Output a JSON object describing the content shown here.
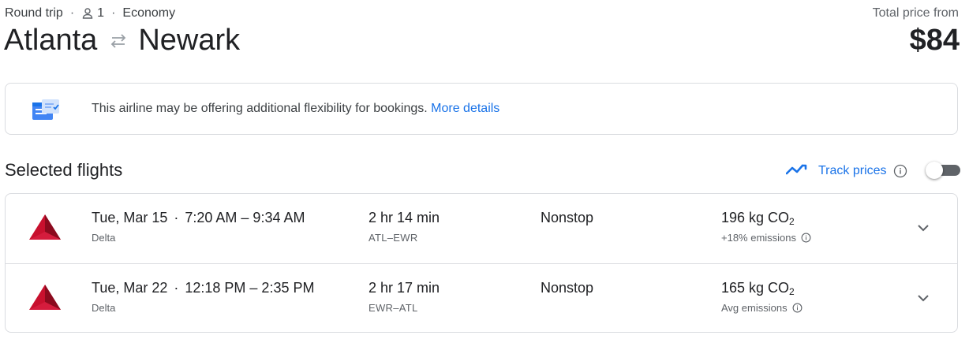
{
  "header": {
    "trip_type": "Round trip",
    "passengers": "1",
    "cabin": "Economy",
    "origin": "Atlanta",
    "destination": "Newark",
    "price_label": "Total price from",
    "price": "$84"
  },
  "banner": {
    "text": "This airline may be offering additional flexibility for bookings.",
    "link": "More details"
  },
  "section": {
    "title": "Selected flights",
    "track_label": "Track prices",
    "track_enabled": false
  },
  "flights": [
    {
      "date": "Tue, Mar 15",
      "times": "7:20 AM – 9:34 AM",
      "airline": "Delta",
      "duration": "2 hr 14 min",
      "route": "ATL–EWR",
      "stops": "Nonstop",
      "co2_value": "196 kg CO",
      "co2_sub": "2",
      "emissions": "+18% emissions"
    },
    {
      "date": "Tue, Mar 22",
      "times": "12:18 PM – 2:35 PM",
      "airline": "Delta",
      "duration": "2 hr 17 min",
      "route": "EWR–ATL",
      "stops": "Nonstop",
      "co2_value": "165 kg CO",
      "co2_sub": "2",
      "emissions": "Avg emissions"
    }
  ],
  "colors": {
    "link": "#1a73e8",
    "delta_red": "#c8102e",
    "border": "#dadce0"
  },
  "icons": [
    "person-icon",
    "swap-arrows-icon",
    "flexible-booking-icon",
    "trend-icon",
    "info-icon",
    "delta-logo",
    "chevron-down-icon"
  ]
}
